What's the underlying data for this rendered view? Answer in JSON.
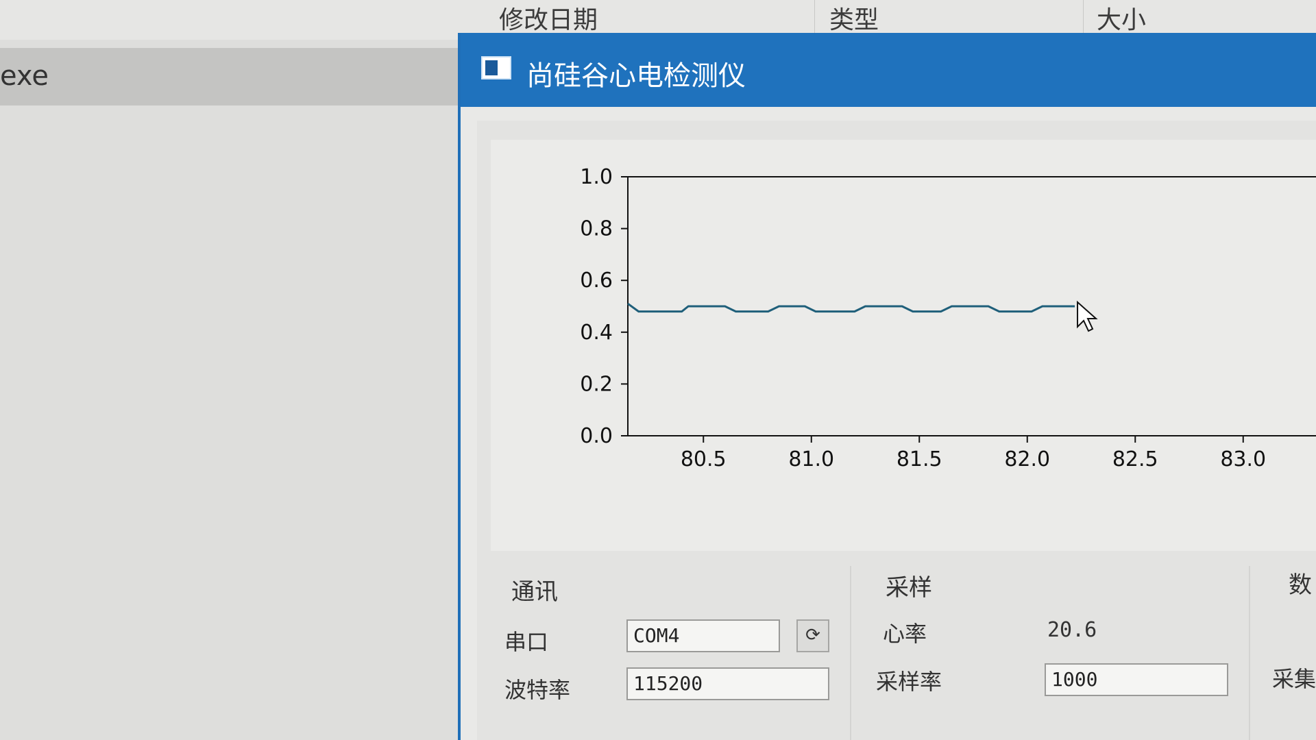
{
  "explorer": {
    "columns": {
      "modified": "修改日期",
      "type": "类型",
      "size": "大小"
    },
    "selected_row": "exe"
  },
  "window": {
    "title": "尚硅谷心电检测仪",
    "icon": "app-window-icon"
  },
  "chart_data": {
    "type": "line",
    "title": "",
    "xlabel": "",
    "ylabel": "",
    "xlim": [
      80.15,
      83.35
    ],
    "ylim": [
      0.0,
      1.0
    ],
    "x_ticks": [
      "80.5",
      "81.0",
      "81.5",
      "82.0",
      "82.5",
      "83.0"
    ],
    "y_ticks": [
      "0.0",
      "0.2",
      "0.4",
      "0.6",
      "0.8",
      "1.0"
    ],
    "grid": false,
    "series": [
      {
        "color": "#1f5f7a",
        "x": [
          80.15,
          80.2,
          80.28,
          80.4,
          80.43,
          80.6,
          80.65,
          80.8,
          80.85,
          80.97,
          81.02,
          81.2,
          81.25,
          81.42,
          81.47,
          81.6,
          81.65,
          81.82,
          81.87,
          82.02,
          82.07,
          82.22
        ],
        "y": [
          0.51,
          0.48,
          0.48,
          0.48,
          0.5,
          0.5,
          0.48,
          0.48,
          0.5,
          0.5,
          0.48,
          0.48,
          0.5,
          0.5,
          0.48,
          0.48,
          0.5,
          0.5,
          0.48,
          0.48,
          0.5,
          0.5
        ]
      }
    ]
  },
  "comm": {
    "group_label": "通讯",
    "port_label": "串口",
    "port_value": "COM4",
    "refresh_icon": "refresh-icon",
    "refresh_glyph": "⟳",
    "baud_label": "波特率",
    "baud_value": "115200"
  },
  "sampling": {
    "group_label": "采样",
    "heart_rate_label": "心率",
    "heart_rate_value": "20.6",
    "sample_rate_label": "采样率",
    "sample_rate_value": "1000"
  },
  "data_group": {
    "group_label_partial": "数",
    "collect_label_partial": "采集"
  }
}
